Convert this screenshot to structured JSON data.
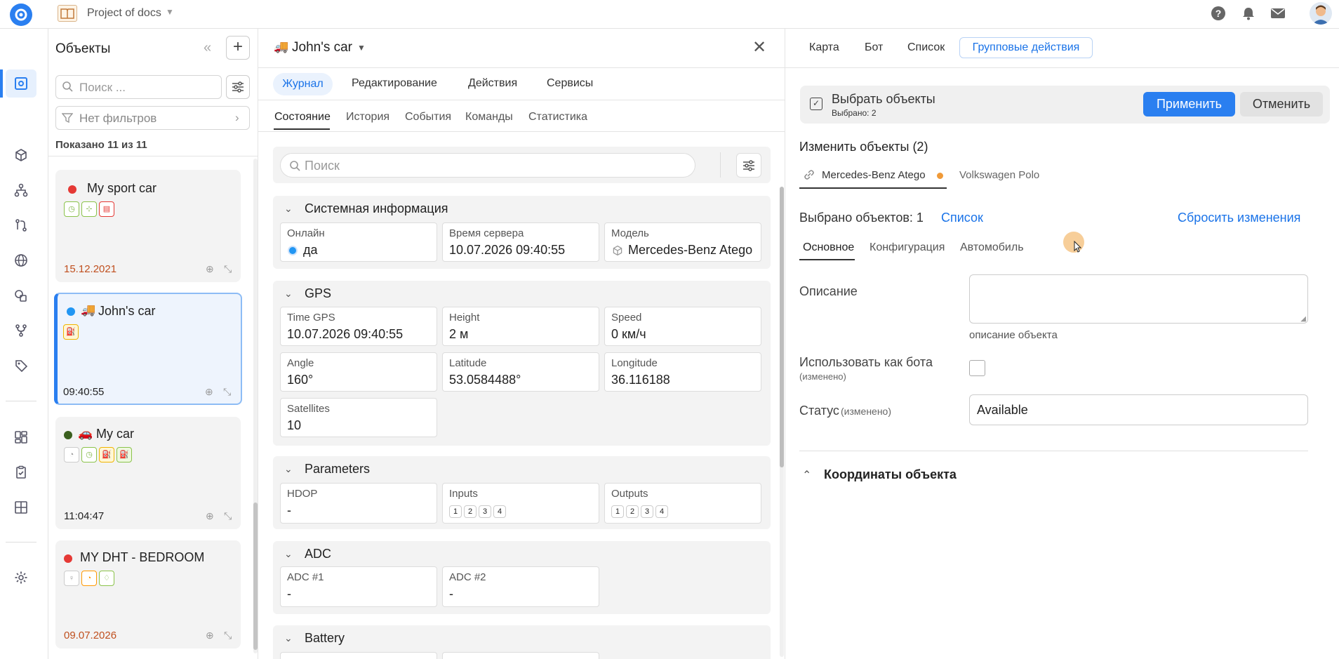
{
  "topbar": {
    "project_label": "Project of docs"
  },
  "objects_panel": {
    "title": "Объекты",
    "search_placeholder": "Поиск ...",
    "filter_label": "Нет фильтров",
    "shown_label": "Показано 11 из 11",
    "cards": [
      {
        "name": "My sport car",
        "status_color": "#e53935",
        "time": "15.12.2021",
        "time_color": "#c0501f",
        "icons": [
          "stopwatch-icon",
          "antenna-icon",
          "clipboard-icon"
        ]
      },
      {
        "name": "John's car",
        "status_color": "#2196f3",
        "time": "09:40:55",
        "time_color": "#333",
        "icons": [
          "fuel-icon"
        ]
      },
      {
        "name": "My car",
        "status_color": "#3a5f1e",
        "time": "11:04:47",
        "time_color": "#333",
        "icons": [
          "speedometer-icon",
          "stopwatch-icon",
          "fuel-icon",
          "fuel-icon"
        ]
      },
      {
        "name": "MY DHT - BEDROOM",
        "status_color": "#e53935",
        "time": "09.07.2026",
        "time_color": "#c0501f",
        "icons": [
          "bulb-icon",
          "speedometer-icon",
          "drop-icon"
        ]
      }
    ]
  },
  "detail": {
    "title": "John's car",
    "tabs": [
      "Журнал",
      "Редактирование",
      "Действия",
      "Сервисы"
    ],
    "subtabs": [
      "Состояние",
      "История",
      "События",
      "Команды",
      "Статистика"
    ],
    "search_placeholder": "Поиск",
    "system": {
      "title": "Системная информация",
      "online_label": "Онлайн",
      "online_value": "да",
      "server_time_label": "Время сервера",
      "server_time_value": "10.07.2026 09:40:55",
      "model_label": "Модель",
      "model_value": "Mercedes-Benz Atego"
    },
    "gps": {
      "title": "GPS",
      "cells": [
        {
          "label": "Time GPS",
          "value": "10.07.2026 09:40:55"
        },
        {
          "label": "Height",
          "value": "2 м"
        },
        {
          "label": "Speed",
          "value": "0 км/ч"
        },
        {
          "label": "Angle",
          "value": "160°"
        },
        {
          "label": "Latitude",
          "value": "53.0584488°"
        },
        {
          "label": "Longitude",
          "value": "36.116188"
        },
        {
          "label": "Satellites",
          "value": "10"
        }
      ]
    },
    "parameters": {
      "title": "Parameters",
      "hdop_label": "HDOP",
      "hdop_value": "-",
      "inputs_label": "Inputs",
      "outputs_label": "Outputs",
      "channels": [
        "1",
        "2",
        "3",
        "4"
      ]
    },
    "adc": {
      "title": "ADC",
      "adc1_label": "ADC #1",
      "adc1_value": "-",
      "adc2_label": "ADC #2",
      "adc2_value": "-"
    },
    "battery": {
      "title": "Battery"
    }
  },
  "right": {
    "tabs": [
      "Карта",
      "Бот",
      "Список",
      "Групповые действия"
    ],
    "select_title": "Выбрать объекты",
    "select_sub": "Выбрано: 2",
    "apply_label": "Применить",
    "cancel_label": "Отменить",
    "change_title": "Изменить объекты (2)",
    "object_tabs": [
      "Mercedes-Benz Atego",
      "Volkswagen Polo"
    ],
    "selected_count": "Выбрано объектов: 1",
    "list_link": "Список",
    "reset_link": "Сбросить изменения",
    "form_tabs": [
      "Основное",
      "Конфигурация",
      "Автомобиль"
    ],
    "desc_label": "Описание",
    "desc_hint": "описание объекта",
    "bot_label": "Использовать как бота",
    "changed_label": "(изменено)",
    "status_label": "Статус",
    "status_value": "Available",
    "coords_title": "Координаты объекта"
  }
}
